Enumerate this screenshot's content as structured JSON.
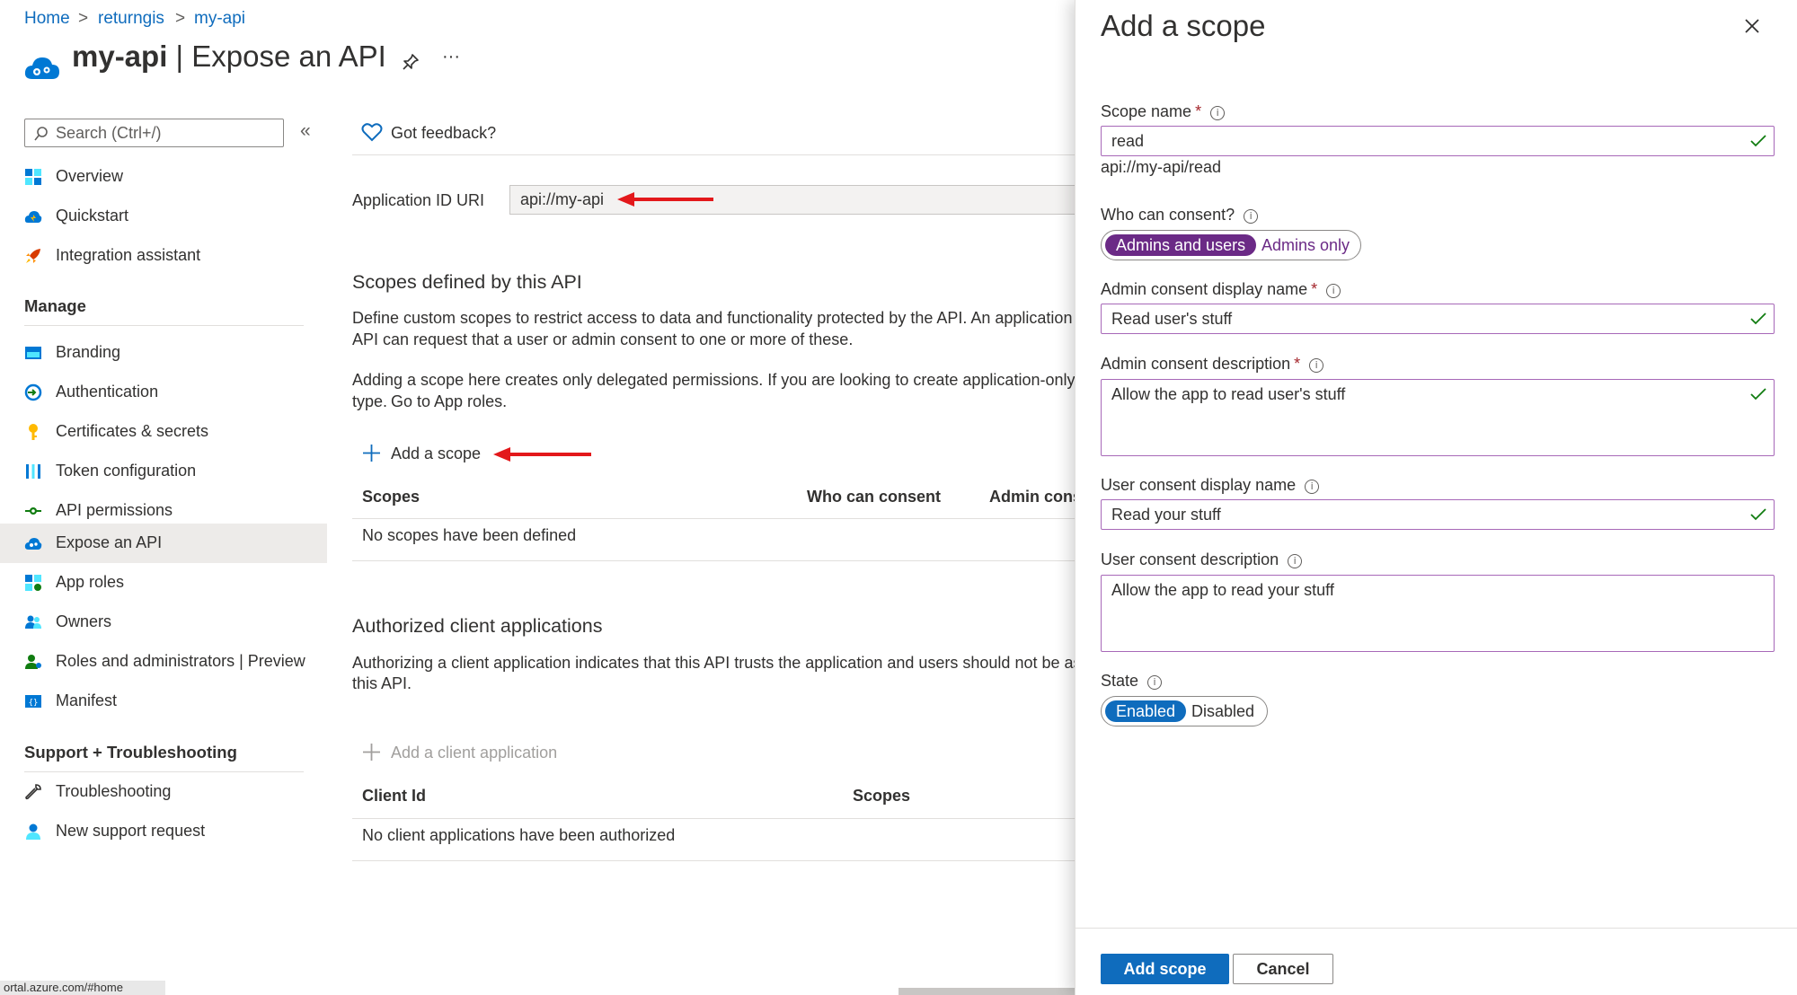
{
  "breadcrumb": {
    "items": [
      "Home",
      "returngis",
      "my-api"
    ],
    "separator": ">"
  },
  "header": {
    "app_name": "my-api",
    "page_name": "Expose an API",
    "separator": "|",
    "more_label": "···"
  },
  "sidebar": {
    "search_placeholder": "Search (Ctrl+/)",
    "collapse_label": "«",
    "items": [
      {
        "label": "Overview",
        "icon": "overview-icon"
      },
      {
        "label": "Quickstart",
        "icon": "quickstart-icon"
      },
      {
        "label": "Integration assistant",
        "icon": "rocket-icon"
      }
    ],
    "manage_heading": "Manage",
    "manage_items": [
      {
        "label": "Branding",
        "icon": "branding-icon"
      },
      {
        "label": "Authentication",
        "icon": "authentication-icon"
      },
      {
        "label": "Certificates & secrets",
        "icon": "key-icon"
      },
      {
        "label": "Token configuration",
        "icon": "token-icon"
      },
      {
        "label": "API permissions",
        "icon": "api-permissions-icon"
      },
      {
        "label": "Expose an API",
        "icon": "cloud-icon",
        "active": true
      },
      {
        "label": "App roles",
        "icon": "app-roles-icon"
      },
      {
        "label": "Owners",
        "icon": "owners-icon"
      },
      {
        "label": "Roles and administrators | Preview",
        "icon": "roles-icon"
      },
      {
        "label": "Manifest",
        "icon": "manifest-icon"
      }
    ],
    "support_heading": "Support + Troubleshooting",
    "support_items": [
      {
        "label": "Troubleshooting",
        "icon": "wrench-icon"
      },
      {
        "label": "New support request",
        "icon": "support-person-icon"
      }
    ]
  },
  "main": {
    "feedback_label": "Got feedback?",
    "app_id_uri_label": "Application ID URI",
    "app_id_uri_value": "api://my-api",
    "scopes_heading": "Scopes defined by this API",
    "scopes_desc_line1": "Define custom scopes to restrict access to data and functionality protected by the API. An application t",
    "scopes_desc_line2": "API can request that a user or admin consent to one or more of these.",
    "delegated_line1": "Adding a scope here creates only delegated permissions. If you are looking to create application-only s",
    "delegated_line2_prefix": "type.",
    "delegated_link": "Go to App roles.",
    "add_scope_label": "Add a scope",
    "scopes_table": {
      "headers": [
        "Scopes",
        "Who can consent",
        "Admin cons"
      ],
      "empty_message": "No scopes have been defined"
    },
    "authorized_heading": "Authorized client applications",
    "authorized_desc_line1": "Authorizing a client application indicates that this API trusts the application and users should not be as",
    "authorized_desc_line2": "this API.",
    "add_client_label": "Add a client application",
    "clients_table": {
      "headers": [
        "Client Id",
        "Scopes"
      ],
      "empty_message": "No client applications have been authorized"
    }
  },
  "panel": {
    "title": "Add a scope",
    "scope_name_label": "Scope name",
    "scope_name_value": "read",
    "scope_uri_preview": "api://my-api/read",
    "who_can_consent_label": "Who can consent?",
    "consent_options": [
      "Admins and users",
      "Admins only"
    ],
    "consent_selected": "Admins and users",
    "admin_display_name_label": "Admin consent display name",
    "admin_display_name_value": "Read user's stuff",
    "admin_description_label": "Admin consent description",
    "admin_description_value": "Allow the app to read user's stuff",
    "user_display_name_label": "User consent display name",
    "user_display_name_value": "Read your stuff",
    "user_description_label": "User consent description",
    "user_description_value": "Allow the app to read your stuff",
    "state_label": "State",
    "state_options": [
      "Enabled",
      "Disabled"
    ],
    "state_selected": "Enabled",
    "required_marker": "*",
    "info_glyph": "i",
    "add_button": "Add scope",
    "cancel_button": "Cancel"
  },
  "status_bar": {
    "url_fragment": "ortal.azure.com/#home"
  },
  "colors": {
    "link_blue": "#0f6cbd",
    "selected_consent_purple": "#6b2a86",
    "selected_state_blue": "#0f6cbd",
    "annotation_arrow_red": "#e3181b",
    "input_border_purple": "#a768b8",
    "valid_check_green": "#107c10"
  }
}
